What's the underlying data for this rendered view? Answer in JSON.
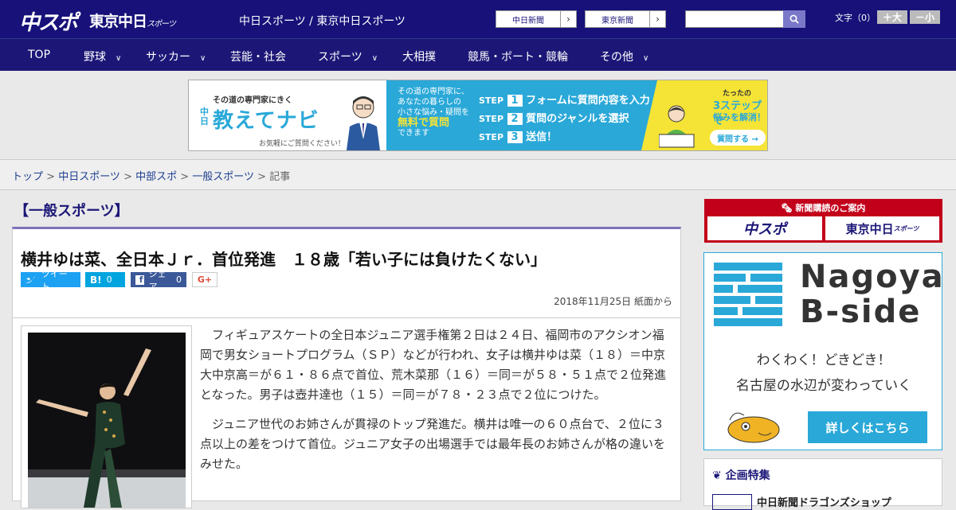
{
  "header": {
    "logo": "中スポ",
    "logo_tokyo": "東京中日",
    "logo_tokyo_small": "スポーツ",
    "site_name": "中日スポーツ / 東京中日スポーツ",
    "chunichi_link": "中日新聞",
    "tokyo_link": "東京新聞",
    "arrow": "›",
    "search_placeholder": "",
    "font_label": "文字（0）",
    "font_plus": "＋大",
    "font_minus": "－小"
  },
  "nav": {
    "items": [
      "TOP",
      "野球",
      "サッカー",
      "芸能・社会",
      "スポーツ",
      "大相撲",
      "競馬・ボート・競輪",
      "その他"
    ]
  },
  "banner": {
    "lead": "その道の専門家にきく",
    "chunichi": "中日",
    "title": "教えてナビ",
    "note": "お気軽にご質問ください！",
    "mid_1": "その道の専門家に、",
    "mid_2": "あなたの暮らしの",
    "mid_3": "小さな悩み・疑問を",
    "mid_free": "無料で質問",
    "mid_4": "できます",
    "step_word": "STEP",
    "steps": [
      {
        "num": "1",
        "text": "フォームに質問内容を入力"
      },
      {
        "num": "2",
        "text": "質問のジャンルを選択"
      },
      {
        "num": "3",
        "text": "送信！"
      }
    ],
    "right_1": "たったの",
    "right_2": "3ステップで",
    "right_3": "悩みを解消！",
    "cta": "質問する →"
  },
  "breadcrumb": {
    "items": [
      "トップ",
      "中日スポーツ",
      "中部スポ",
      "一般スポーツ"
    ],
    "sep": " > ",
    "current": "記事"
  },
  "article": {
    "category": "【一般スポーツ】",
    "title": "横井ゆは菜、全日本Ｊｒ．首位発進　１８歳「若い子には負けたくない」",
    "date": "2018年11月25日 紙面から",
    "share": {
      "tweet": "ツイート",
      "hatena": "B!",
      "hatena_count": "0",
      "facebook": "シェア",
      "facebook_count": "0",
      "gplus": "G+"
    },
    "paragraphs": [
      "フィギュアスケートの全日本ジュニア選手権第２日は２４日、福岡市のアクシオン福岡で男女ショートプログラム（ＳＰ）などが行われ、女子は横井ゆは菜（１８）＝中京大中京高＝が６１・８６点で首位、荒木菜那（１６）＝同＝が５８・５１点で２位発進となった。男子は壺井達也（１５）＝同＝が７８・２３点で２位につけた。",
      "ジュニア世代のお姉さんが貫禄のトップ発進だ。横井は唯一の６０点台で、２位に３点以上の差をつけて首位。ジュニア女子の出場選手では最年長のお姉さんが格の違いをみせた。"
    ]
  },
  "sidebar": {
    "subscribe": {
      "title": "新聞購読のご案内",
      "logo_chuspo": "中スポ",
      "logo_tokyo": "東京中日",
      "logo_tokyo_small": "スポーツ"
    },
    "ad": {
      "title_1": "Nagoya",
      "title_2": "B-side",
      "line_1": "わくわく！どきどき！",
      "line_2": "名古屋の水辺が変わっていく",
      "button": "詳しくはこちら"
    },
    "kikaku": {
      "title": "企画特集",
      "item": "中日新聞ドラゴンズショップ"
    }
  },
  "colors": {
    "header_bg": "#171179",
    "accent_blue": "#2aa8d8",
    "accent_red": "#c2001a",
    "yellow": "#f5e436"
  }
}
